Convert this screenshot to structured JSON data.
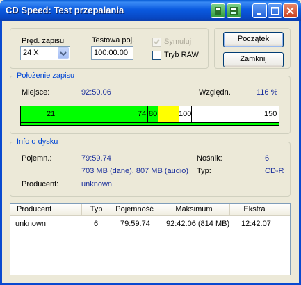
{
  "window": {
    "title": "CD Speed: Test przepalania"
  },
  "settings": {
    "speed_label": "Pręd. zapisu",
    "speed_value": "24 X",
    "test_pos_label": "Testowa poj.",
    "test_pos_value": "100:00.00",
    "simulate_label": "Symuluj",
    "raw_label": "Tryb RAW",
    "start_button": "Początek",
    "close_button": "Zamknij"
  },
  "position": {
    "group_title": "Położenie zapisu",
    "place_label": "Miejsce:",
    "place_value": "92:50.06",
    "relative_label": "Względn.",
    "relative_value": "116 %",
    "bar": {
      "max": 150,
      "segments": [
        {
          "label": "21",
          "value": 21,
          "end": 74,
          "color": "#00FF00"
        },
        {
          "label": "74",
          "value": 74,
          "end": 80,
          "color": "#00FF00"
        },
        {
          "label": "80",
          "value": 80,
          "end": 100,
          "color": "#FFFF00"
        },
        {
          "label": "100",
          "value": 100,
          "end": 150,
          "color": "#FFFFFF"
        },
        {
          "label": "150",
          "value": 150
        }
      ],
      "progress_fraction": 1.0
    }
  },
  "disc": {
    "group_title": "Info o dysku",
    "capacity_label": "Pojemn.:",
    "capacity_value": "79:59.74",
    "capacity_detail": "703 MB (dane), 807 MB (audio)",
    "producer_label": "Producent:",
    "producer_value": "unknown",
    "media_label": "Nośnik:",
    "media_value": "6",
    "type_label": "Typ:",
    "type_value": "CD-R"
  },
  "table": {
    "columns": [
      "Producent",
      "Typ",
      "Pojemność",
      "Maksimum",
      "Ekstra"
    ],
    "rows": [
      [
        "unknown",
        "6",
        "79:59.74",
        "92:42.06 (814 MB)",
        "12:42.07"
      ]
    ]
  },
  "colors": {
    "green": "#00FF00",
    "yellow": "#FFFF00",
    "titlebar": "#0A5AE0"
  }
}
